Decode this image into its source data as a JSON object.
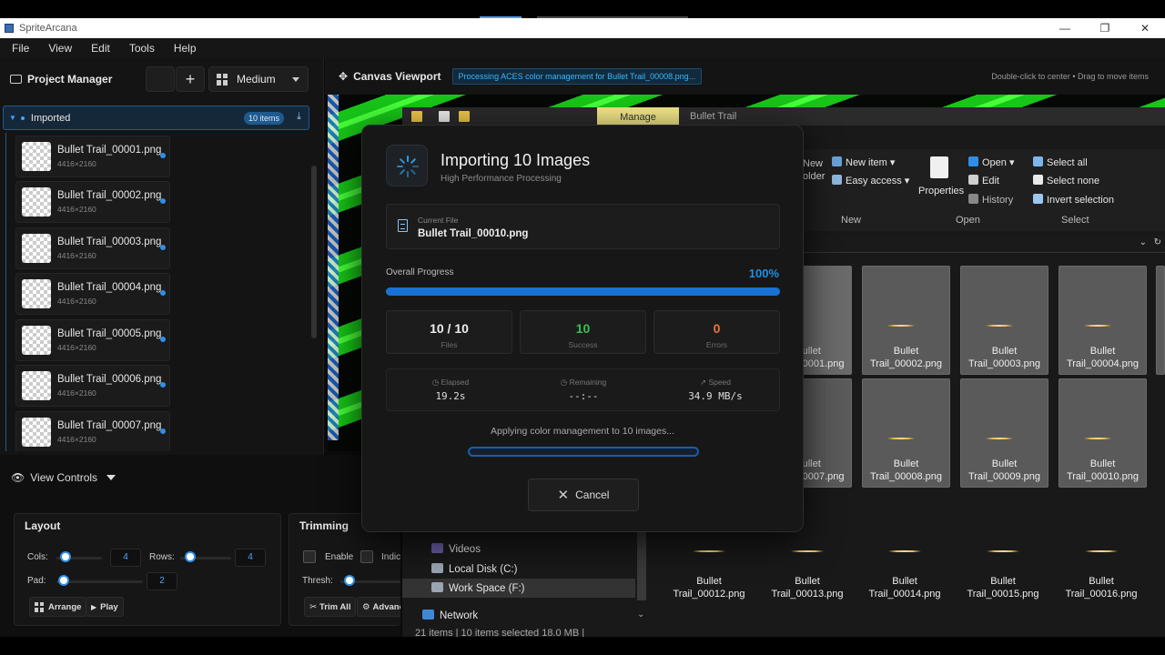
{
  "window": {
    "title": "SpriteArcana",
    "minimize": "—",
    "maximize": "❐",
    "close": "✕"
  },
  "menu": [
    "File",
    "View",
    "Edit",
    "Tools",
    "Help"
  ],
  "project_manager": {
    "title": "Project Manager",
    "add_glyph": "+",
    "size_select": "Medium",
    "folder": {
      "name": "Imported",
      "count": "10 items"
    },
    "files": [
      {
        "name": "Bullet Trail_00001.png",
        "dims": "4416×2160"
      },
      {
        "name": "Bullet Trail_00002.png",
        "dims": "4416×2160"
      },
      {
        "name": "Bullet Trail_00003.png",
        "dims": "4416×2160"
      },
      {
        "name": "Bullet Trail_00004.png",
        "dims": "4416×2160"
      },
      {
        "name": "Bullet Trail_00005.png",
        "dims": "4416×2160"
      },
      {
        "name": "Bullet Trail_00006.png",
        "dims": "4416×2160"
      },
      {
        "name": "Bullet Trail_00007.png",
        "dims": "4416×2160"
      }
    ]
  },
  "view_controls": {
    "label": "View Controls"
  },
  "layout_panel": {
    "title": "Layout",
    "cols_label": "Cols:",
    "cols_value": "4",
    "rows_label": "Rows:",
    "rows_value": "4",
    "pad_label": "Pad:",
    "pad_value": "2",
    "arrange_label": "Arrange",
    "play_label": "Play"
  },
  "trimming_panel": {
    "title": "Trimming",
    "enable_label": "Enable",
    "indicator_label": "Indic",
    "thresh_label": "Thresh:",
    "trim_all_label": "Trim All",
    "advanced_label": "Advanc"
  },
  "canvas": {
    "title": "Canvas Viewport",
    "status": "Processing ACES color management for Bullet Trail_00008.png...",
    "hint": "Double-click to center • Drag to move items"
  },
  "explorer": {
    "manage_tab": "Manage",
    "path": "Bullet Trail",
    "ribbon": {
      "new_item": "New item ▾",
      "easy_access": "Easy access ▾",
      "new_folder_a": "New",
      "new_folder_b": "older",
      "properties": "Properties",
      "open": "Open ▾",
      "edit": "Edit",
      "history": "History",
      "select_all": "Select all",
      "select_none": "Select none",
      "invert": "Invert selection",
      "group_new": "New",
      "group_open": "Open",
      "group_select": "Select"
    },
    "tiles_row1": [
      {
        "a": "Bullet",
        "b": "Trail_00001.png"
      },
      {
        "a": "Bullet",
        "b": "Trail_00002.png"
      },
      {
        "a": "Bullet",
        "b": "Trail_00003.png"
      },
      {
        "a": "Bullet",
        "b": "Trail_00004.png"
      }
    ],
    "tiles_row2": [
      {
        "a": "Bullet",
        "b": "Trail_00007.png"
      },
      {
        "a": "Bullet",
        "b": "Trail_00008.png"
      },
      {
        "a": "Bullet",
        "b": "Trail_00009.png"
      },
      {
        "a": "Bullet",
        "b": "Trail_00010.png"
      }
    ],
    "tiles_row3": [
      {
        "a": "Bullet",
        "b": "Trail_00012.png"
      },
      {
        "a": "Bullet",
        "b": "Trail_00013.png"
      },
      {
        "a": "Bullet",
        "b": "Trail_00014.png"
      },
      {
        "a": "Bullet",
        "b": "Trail_00015.png"
      },
      {
        "a": "Bullet",
        "b": "Trail_00016.png"
      }
    ],
    "nav": [
      "Videos",
      "Local Disk (C:)",
      "Work Space (F:)",
      "Network"
    ],
    "status": "21 items  |  10 items selected  18.0 MB  |"
  },
  "modal": {
    "title": "Importing 10 Images",
    "subtitle": "High Performance Processing",
    "current_file_label": "Current File",
    "current_file": "Bullet Trail_00010.png",
    "overall_label": "Overall Progress",
    "progress_pct": "100%",
    "progress_fraction": 1.0,
    "files_value": "10 / 10",
    "files_label": "Files",
    "success_value": "10",
    "success_label": "Success",
    "errors_value": "0",
    "errors_label": "Errors",
    "elapsed_label": "Elapsed",
    "elapsed_value": "19.2s",
    "remaining_label": "Remaining",
    "remaining_value": "--:--",
    "speed_label": "Speed",
    "speed_value": "34.9 MB/s",
    "applying": "Applying color management to 10 images...",
    "cancel": "Cancel"
  },
  "colors": {
    "accent": "#1f8fe5",
    "success": "#35c24f",
    "error": "#e8743b",
    "canvas_green": "#18c618"
  }
}
